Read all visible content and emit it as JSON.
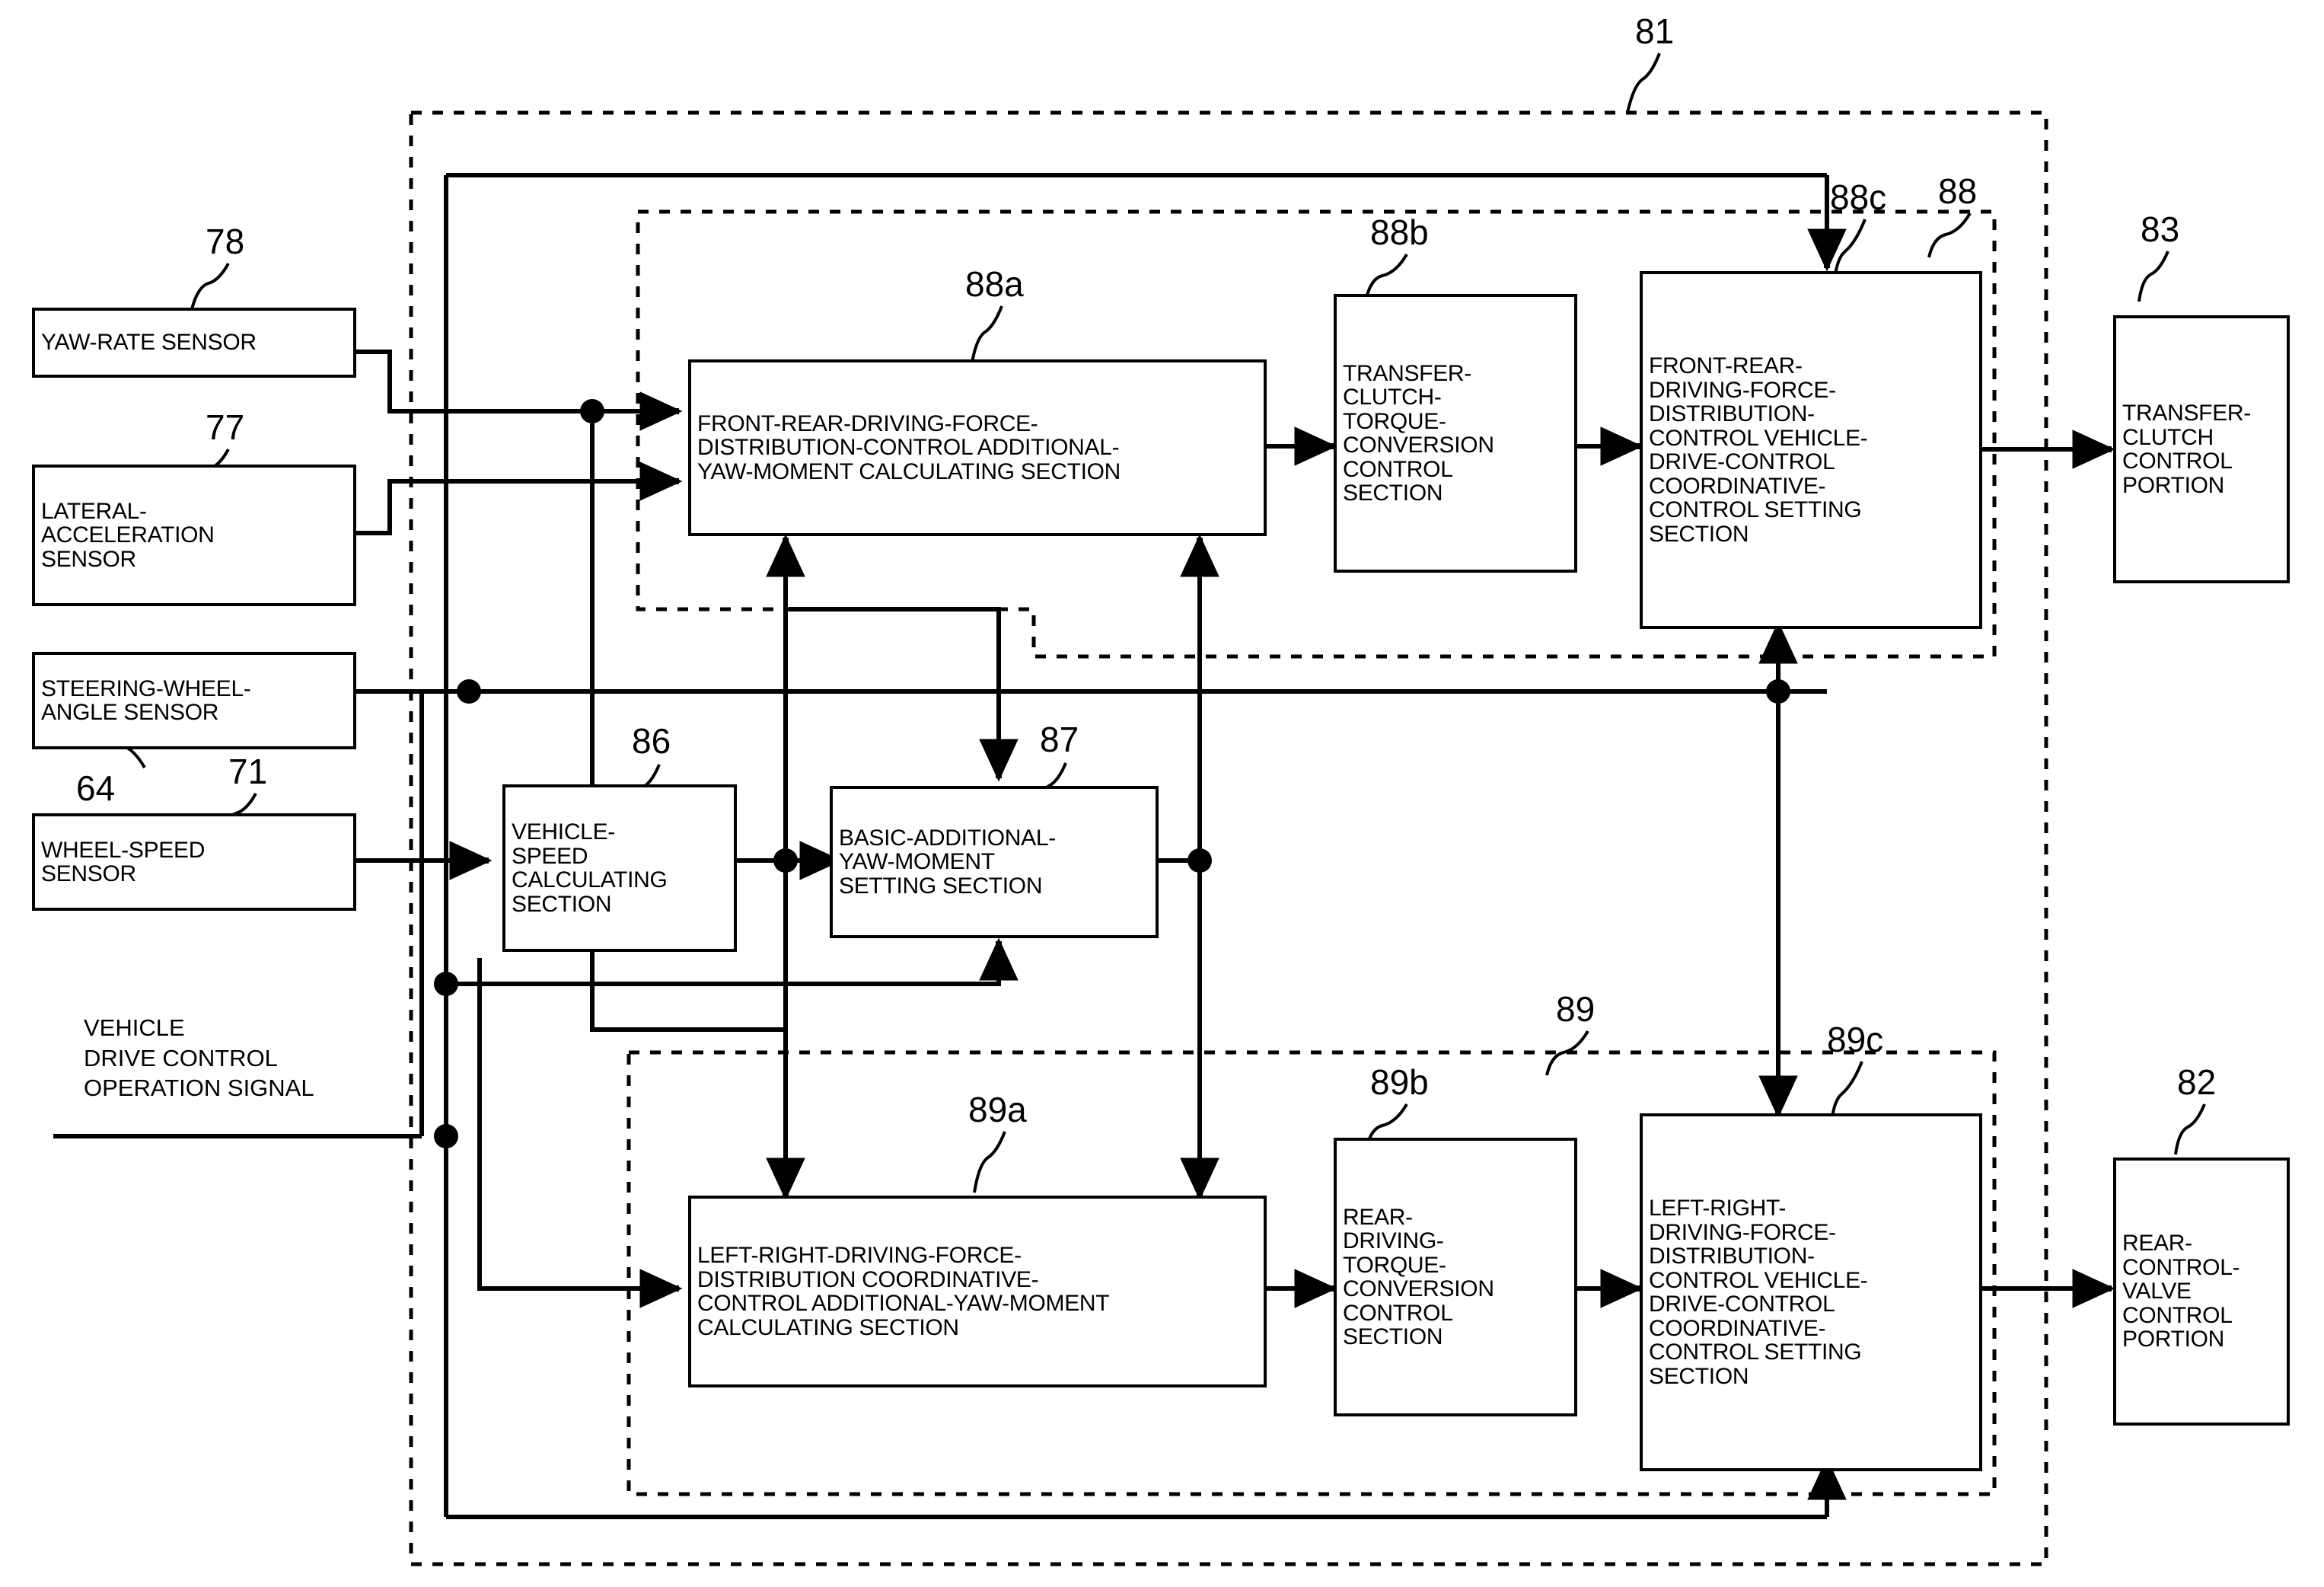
{
  "figure": {
    "domain": "patent-block-diagram",
    "outer_ref": "81",
    "free_labels": [
      {
        "name": "vehicle-drive-control-operation-signal",
        "text": "VEHICLE\nDRIVE CONTROL\nOPERATION SIGNAL"
      }
    ]
  },
  "refs": {
    "outer_controller": "81",
    "yaw_rate_sensor": "78",
    "lateral_accel_sensor": "77",
    "steering_angle_sensor": "64",
    "wheel_speed_sensor": "71",
    "vehicle_speed_calc": "86",
    "basic_yaw_moment": "87",
    "front_rear_group": "88",
    "front_rear_calc": "88a",
    "transfer_clutch_conv": "88b",
    "front_rear_setting": "88c",
    "left_right_group": "89",
    "left_right_calc": "89a",
    "rear_torque_conv": "89b",
    "left_right_setting": "89c",
    "transfer_clutch_portion": "83",
    "rear_control_valve_portion": "82"
  },
  "blocks": {
    "yaw_rate_sensor": {
      "label": "YAW-RATE SENSOR",
      "ref": "78"
    },
    "lateral_accel_sensor": {
      "label": "LATERAL-\nACCELERATION\nSENSOR",
      "ref": "77"
    },
    "steering_angle_sensor": {
      "label": "STEERING-WHEEL-\nANGLE SENSOR",
      "ref": "64"
    },
    "wheel_speed_sensor": {
      "label": "WHEEL-SPEED\nSENSOR",
      "ref": "71"
    },
    "vehicle_speed_calc": {
      "label": "VEHICLE-\nSPEED\nCALCULATING\nSECTION",
      "ref": "86"
    },
    "basic_yaw_moment": {
      "label": "BASIC-ADDITIONAL-\nYAW-MOMENT\nSETTING SECTION",
      "ref": "87"
    },
    "front_rear_calc": {
      "label": "FRONT-REAR-DRIVING-FORCE-\nDISTRIBUTION-CONTROL ADDITIONAL-\nYAW-MOMENT CALCULATING SECTION",
      "ref": "88a"
    },
    "transfer_clutch_conv": {
      "label": "TRANSFER-\nCLUTCH-\nTORQUE-\nCONVERSION\nCONTROL\nSECTION",
      "ref": "88b"
    },
    "front_rear_setting": {
      "label": "FRONT-REAR-\nDRIVING-FORCE-\nDISTRIBUTION-\nCONTROL VEHICLE-\nDRIVE-CONTROL\nCOORDINATIVE-\nCONTROL SETTING\nSECTION",
      "ref": "88c"
    },
    "transfer_clutch_portion": {
      "label": "TRANSFER-\nCLUTCH\nCONTROL\nPORTION",
      "ref": "83"
    },
    "left_right_calc": {
      "label": "LEFT-RIGHT-DRIVING-FORCE-\nDISTRIBUTION COORDINATIVE-\nCONTROL ADDITIONAL-YAW-MOMENT\nCALCULATING SECTION",
      "ref": "89a"
    },
    "rear_torque_conv": {
      "label": "REAR-\nDRIVING-\nTORQUE-\nCONVERSION\nCONTROL\nSECTION",
      "ref": "89b"
    },
    "left_right_setting": {
      "label": "LEFT-RIGHT-\nDRIVING-FORCE-\nDISTRIBUTION-\nCONTROL VEHICLE-\nDRIVE-CONTROL\nCOORDINATIVE-\nCONTROL SETTING\nSECTION",
      "ref": "89c"
    },
    "rear_control_valve_portion": {
      "label": "REAR-\nCONTROL-\nVALVE\nCONTROL\nPORTION",
      "ref": "82"
    }
  },
  "colors": {
    "line": "#000000",
    "background": "#ffffff"
  }
}
